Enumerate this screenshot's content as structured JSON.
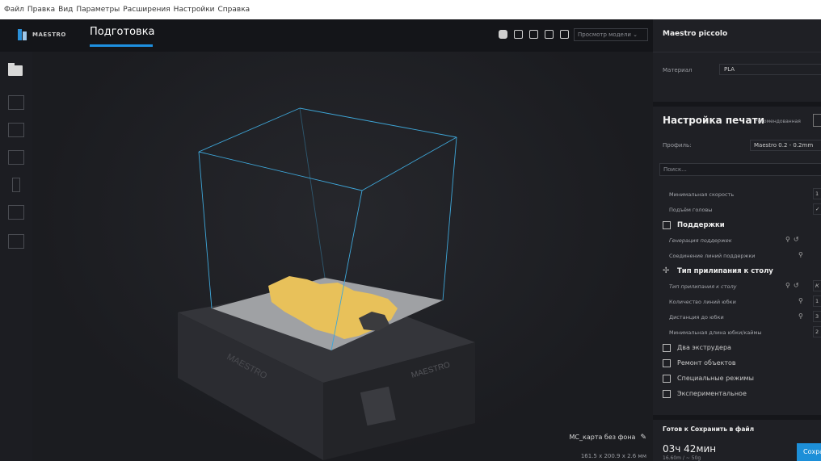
{
  "menubar": [
    "Файл",
    "Правка",
    "Вид",
    "Параметры",
    "Расширения",
    "Настройки",
    "Справка"
  ],
  "header": {
    "logo": "MAESTRO",
    "tab": "Подготовка",
    "view_select": "Просмотр модели"
  },
  "viewport": {
    "model_name": "MC_карта без фона",
    "model_dims": "161.5 x 200.9 x 2.6 мм",
    "bed_brand": "MAESTRO"
  },
  "panel": {
    "printer": "Maestro piccolo",
    "material_label": "Материал",
    "material_value": "PLA",
    "setup_title": "Настройка печати",
    "setup_mode": "Рекомендованная",
    "profile_label": "Профиль:",
    "profile_value": "Maestro 0.2 - 0.2mm",
    "search_placeholder": "Поиск...",
    "rows": [
      {
        "label": "Минимальная скорость",
        "value": "1"
      },
      {
        "label": "Подъём головы",
        "value": "✓"
      },
      {
        "label": "Поддержки"
      },
      {
        "label": "Генерация поддержек"
      },
      {
        "label": "Соединение линий поддержки"
      },
      {
        "label": "Тип прилипания к столу"
      },
      {
        "label": "Тип прилипания к столу",
        "value": "К"
      },
      {
        "label": "Количество линий юбки",
        "value": "1"
      },
      {
        "label": "Дистанция до юбки",
        "value": "3"
      },
      {
        "label": "Минимальная длина юбки/каймы",
        "value": "2"
      },
      {
        "label": "Два экструдера"
      },
      {
        "label": "Ремонт объектов"
      },
      {
        "label": "Специальные режимы"
      },
      {
        "label": "Экспериментальное"
      }
    ],
    "ready": "Готов к Сохранить в файл",
    "time": "03ч 42мин",
    "material_use": "16.60m / ~ 50g",
    "save": "Сохранить"
  },
  "colors": {
    "accent": "#1e90e0",
    "model": "#e8c15a",
    "box_lines": "#3ea6d8"
  }
}
